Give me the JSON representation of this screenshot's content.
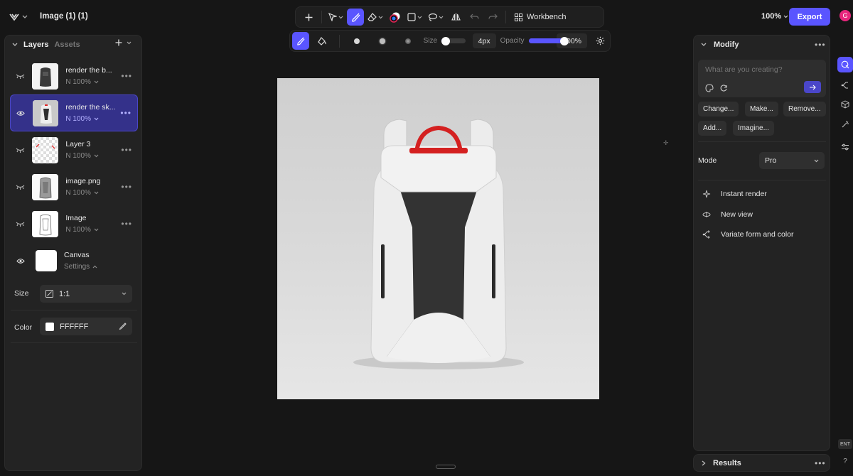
{
  "app": {
    "doc_title": "Image (1) (1)",
    "zoom": "100%",
    "export_label": "Export",
    "avatar_initial": "G"
  },
  "toolbar": {
    "workbench_label": "Workbench"
  },
  "brush": {
    "size_label": "Size",
    "size_value": "4px",
    "opacity_label": "Opacity",
    "opacity_value": "100%",
    "size_fraction": 0.05,
    "opacity_fraction": 1.0
  },
  "left_panel": {
    "tabs": {
      "layers": "Layers",
      "assets": "Assets"
    },
    "layers": [
      {
        "name": "render the b...",
        "sub": "N 100%"
      },
      {
        "name": "render the sk...",
        "sub": "N 100%"
      },
      {
        "name": "Layer 3",
        "sub": "N 100%"
      },
      {
        "name": "image.png",
        "sub": "N 100%"
      },
      {
        "name": "Image",
        "sub": "N 100%"
      },
      {
        "name": "Canvas",
        "sub": "Settings"
      }
    ],
    "size": {
      "label": "Size",
      "value": "1:1"
    },
    "color": {
      "label": "Color",
      "value": "FFFFFF"
    }
  },
  "right_panel": {
    "title": "Modify",
    "prompt_placeholder": "What are you creating?",
    "chips": [
      "Change...",
      "Make...",
      "Remove...",
      "Add...",
      "Imagine..."
    ],
    "mode": {
      "label": "Mode",
      "value": "Pro"
    },
    "actions": [
      "Instant render",
      "New view",
      "Variate form and color"
    ],
    "results_label": "Results"
  },
  "rail": {
    "ent_label": "ENT",
    "help_label": "?"
  },
  "colors": {
    "accent": "#5a55ff",
    "bg": "#161616",
    "panel": "#232323",
    "selected_layer": "#34318a"
  }
}
